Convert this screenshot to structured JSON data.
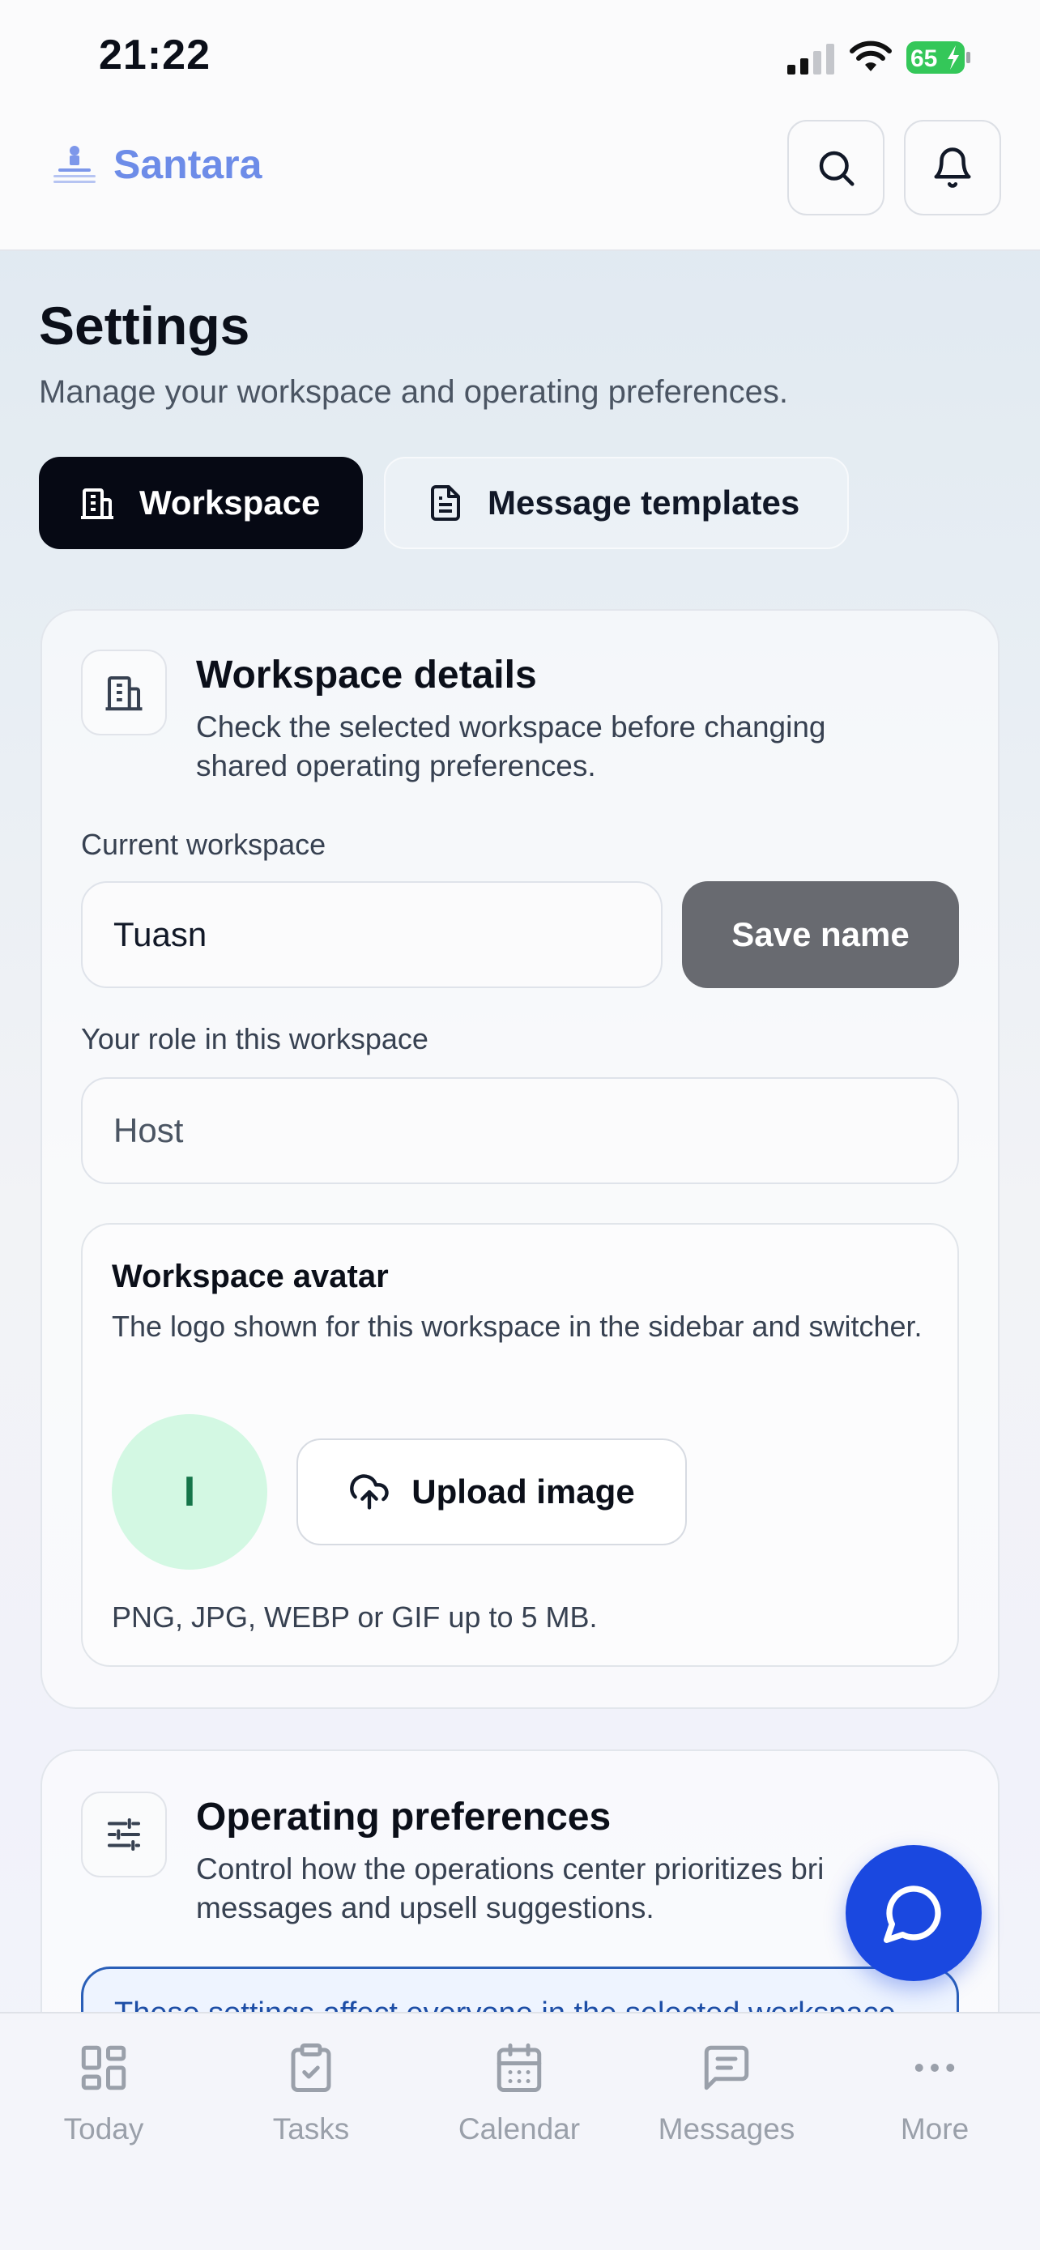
{
  "status_bar": {
    "time": "21:22",
    "battery": "65"
  },
  "app": {
    "brand": "Santara"
  },
  "header": {
    "title": "Settings",
    "subtitle": "Manage your workspace and operating preferences."
  },
  "tabs": [
    {
      "label": "Workspace",
      "active": true
    },
    {
      "label": "Message templates",
      "active": false
    }
  ],
  "workspace_card": {
    "title": "Workspace details",
    "description": "Check the selected workspace before changing shared operating preferences.",
    "current_workspace_label": "Current workspace",
    "current_workspace_value": "Tuasn",
    "save_label": "Save name",
    "role_label": "Your role in this workspace",
    "role_value": "Host",
    "avatar": {
      "title": "Workspace avatar",
      "description": "The logo shown for this workspace in the sidebar and switcher.",
      "initial": "I",
      "upload_label": "Upload image",
      "hint": "PNG, JPG, WEBP or GIF up to 5 MB."
    }
  },
  "preferences_card": {
    "title": "Operating preferences",
    "description": "Control how the operations center prioritizes bri messages and upsell suggestions.",
    "notice": "These settings affect everyone in the selected workspace"
  },
  "bottom_nav": [
    {
      "label": "Today",
      "icon": "grid-icon"
    },
    {
      "label": "Tasks",
      "icon": "clipboard-check-icon"
    },
    {
      "label": "Calendar",
      "icon": "calendar-icon"
    },
    {
      "label": "Messages",
      "icon": "message-square-icon"
    },
    {
      "label": "More",
      "icon": "more-dots-icon"
    }
  ],
  "colors": {
    "brand": "#6d8ce8",
    "tab_active_bg": "#060914",
    "save_button": "#686a70",
    "avatar_bg": "#d3f8e3",
    "avatar_text": "#16754a",
    "fab": "#1a48e0",
    "notice_border": "#2a5fb8",
    "battery": "#34c759"
  }
}
